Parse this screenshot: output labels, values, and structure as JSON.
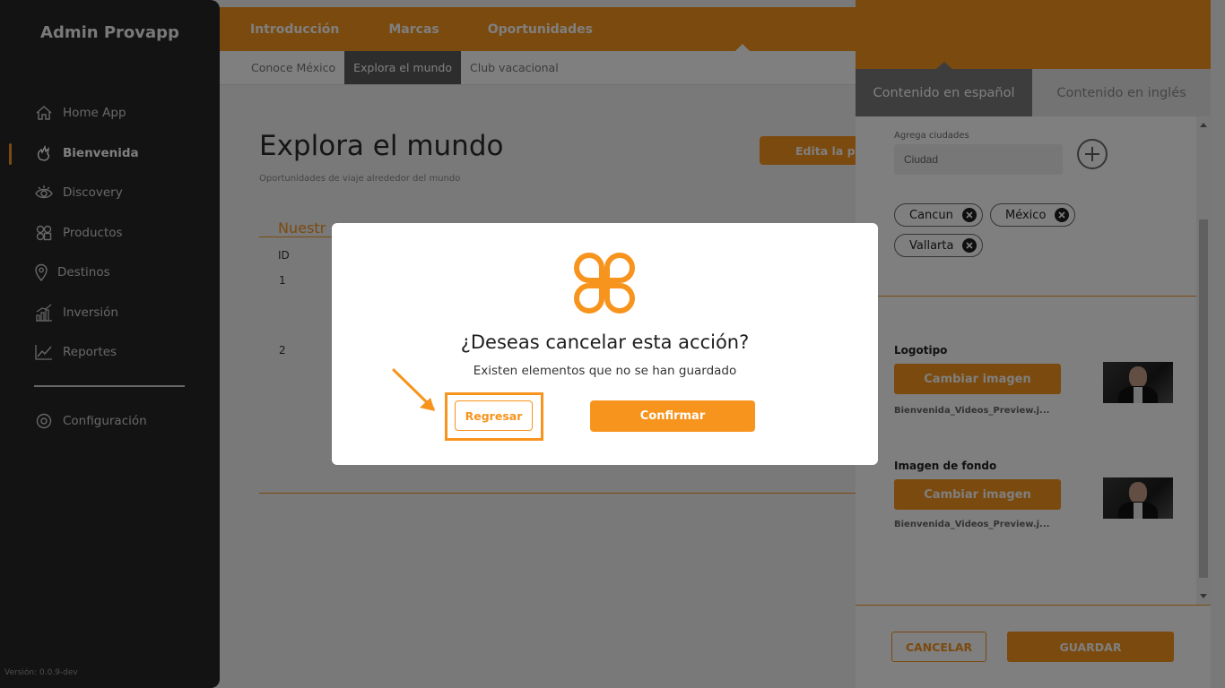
{
  "sidebar": {
    "brand": "Admin Provapp",
    "items": [
      {
        "label": "Home App",
        "icon": "home-icon"
      },
      {
        "label": "Bienvenida",
        "icon": "hand-icon",
        "active": true
      },
      {
        "label": "Discovery",
        "icon": "eye-icon"
      },
      {
        "label": "Productos",
        "icon": "grid-icon"
      },
      {
        "label": "Destinos",
        "icon": "location-pin-icon"
      },
      {
        "label": "Inversión",
        "icon": "bar-chart-icon"
      },
      {
        "label": "Reportes",
        "icon": "line-chart-icon"
      }
    ],
    "settings": {
      "label": "Configuración",
      "icon": "gear-icon"
    },
    "version": "Versión: 0.0.9-dev"
  },
  "topnav": {
    "tabs": [
      "Introducción",
      "Marcas",
      "Oportunidades"
    ],
    "active_tab": "Oportunidades"
  },
  "subnav": {
    "tabs": [
      "Conoce México",
      "Explora el mundo",
      "Club vacacional"
    ],
    "active_tab": "Explora el mundo"
  },
  "main": {
    "title": "Explora el mundo",
    "subtitle": "Oportunidades de viaje alrededor del mundo",
    "edit_button": "Edita la p",
    "section_title": "Nuestr",
    "table": {
      "columns": [
        "ID"
      ],
      "rows": [
        {
          "id": "1"
        },
        {
          "id": "2"
        }
      ]
    }
  },
  "drawer": {
    "tabs": [
      "Contenido en español",
      "Contenido en inglés"
    ],
    "active_tab": "Contenido en español",
    "cities": {
      "label": "Agrega ciudades",
      "placeholder": "Ciudad",
      "chips": [
        "Cancun",
        "México",
        "Vallarta"
      ]
    },
    "logo": {
      "label": "Logotipo",
      "button": "Cambiar imagen",
      "file": "Bienvenida_Videos_Preview.j..."
    },
    "background": {
      "label": "Imagen de fondo",
      "button": "Cambiar imagen",
      "file": "Bienvenida_Videos_Preview.j..."
    },
    "cancel": "CANCELAR",
    "save": "GUARDAR"
  },
  "dialog": {
    "question": "¿Deseas cancelar esta acción?",
    "message": "Existen elementos que no se han guardado",
    "back_button": "Regresar",
    "confirm_button": "Confirmar"
  },
  "colors": {
    "accent": "#f7941d",
    "sidebar_bg": "#272727",
    "overlay": "rgba(0,0,0,0.5)"
  }
}
